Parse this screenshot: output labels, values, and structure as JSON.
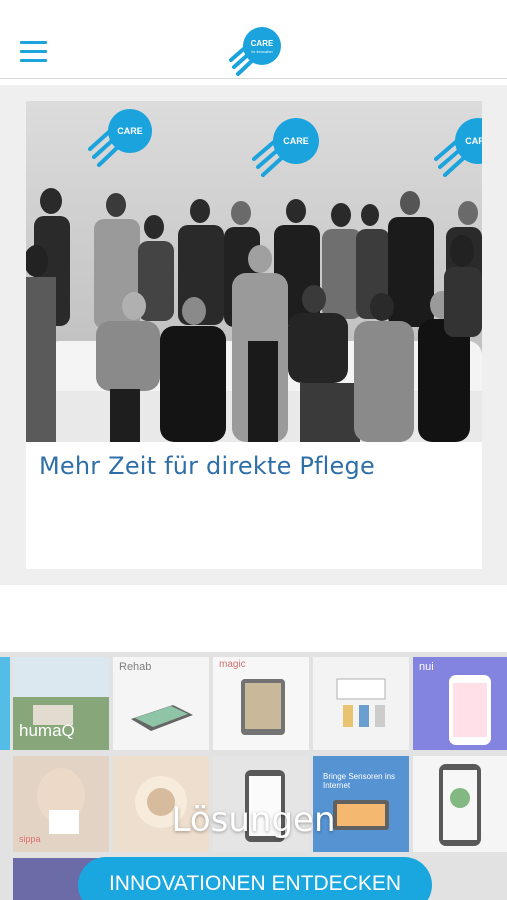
{
  "header": {
    "menu_icon": "hamburger-menu-icon",
    "logo_text": "CARE",
    "logo_subtext": "for Innovation",
    "accent_color": "#1aa3dc"
  },
  "hero": {
    "title": "Mehr Zeit für direkte Pflege",
    "photo_banner_logos": [
      "CARE",
      "CARE",
      "CARE"
    ]
  },
  "solutions": {
    "title": "Lösungen",
    "cta_label": "INNOVATIONEN ENTDECKEN",
    "tile_labels": {
      "humaq": "humaQ",
      "rehab": "Rehab",
      "magic": "magic",
      "nui": "nui",
      "sippa": "sippa",
      "sensors": "Bringe Sensoren ins Internet"
    }
  }
}
